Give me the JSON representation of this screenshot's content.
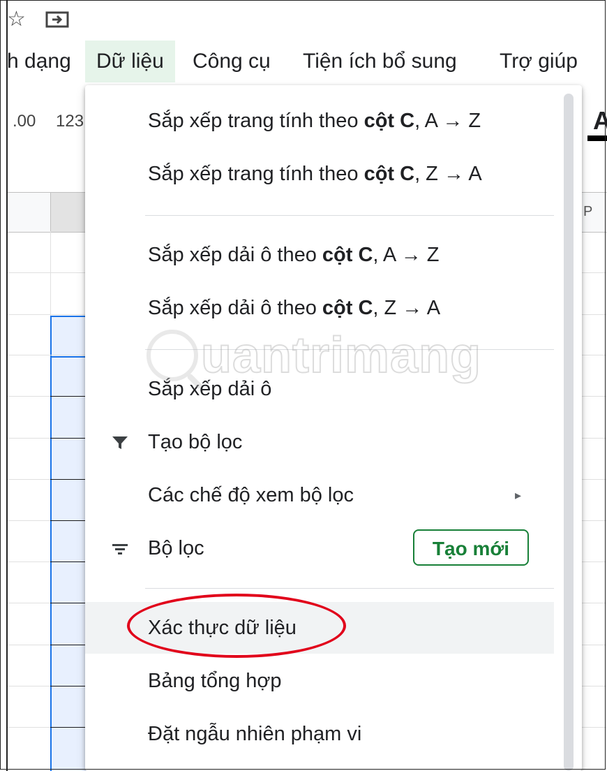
{
  "top_icons": {
    "star": "star-icon",
    "move": "move-to-folder-icon"
  },
  "menubar": {
    "format_partial": "h dạng",
    "data": "Dữ liệu",
    "tools": "Công cụ",
    "addons": "Tiện ích bổ sung",
    "help": "Trợ giúp"
  },
  "toolbar": {
    "decimal": ".00",
    "number_format": "123",
    "font_style": "A"
  },
  "grid": {
    "column_header_partial": "P"
  },
  "dropdown": {
    "items": [
      {
        "prefix": "Sắp xếp trang tính theo ",
        "bold": "cột C",
        "suffix": ", A → Z"
      },
      {
        "prefix": "Sắp xếp trang tính theo ",
        "bold": "cột C",
        "suffix": ", Z → A"
      },
      {
        "prefix": "Sắp xếp dải ô theo ",
        "bold": "cột C",
        "suffix": ", A → Z"
      },
      {
        "prefix": "Sắp xếp dải ô theo ",
        "bold": "cột C",
        "suffix": ", Z → A"
      },
      {
        "label": "Sắp xếp dải ô"
      },
      {
        "label": "Tạo bộ lọc",
        "icon": "filter-icon"
      },
      {
        "label": "Các chế độ xem bộ lọc",
        "arrow": "▸"
      },
      {
        "label": "Bộ lọc",
        "icon": "filter-list-icon",
        "button": "Tạo mới"
      },
      {
        "label": "Xác thực dữ liệu"
      },
      {
        "label": "Bảng tổng hợp"
      },
      {
        "label": "Đặt ngẫu nhiên phạm vi"
      }
    ]
  },
  "watermark": {
    "text": "uantrimang"
  },
  "colors": {
    "accent_green": "#188038",
    "highlight_red": "#e1001a",
    "selection_blue": "#1a73e8"
  }
}
